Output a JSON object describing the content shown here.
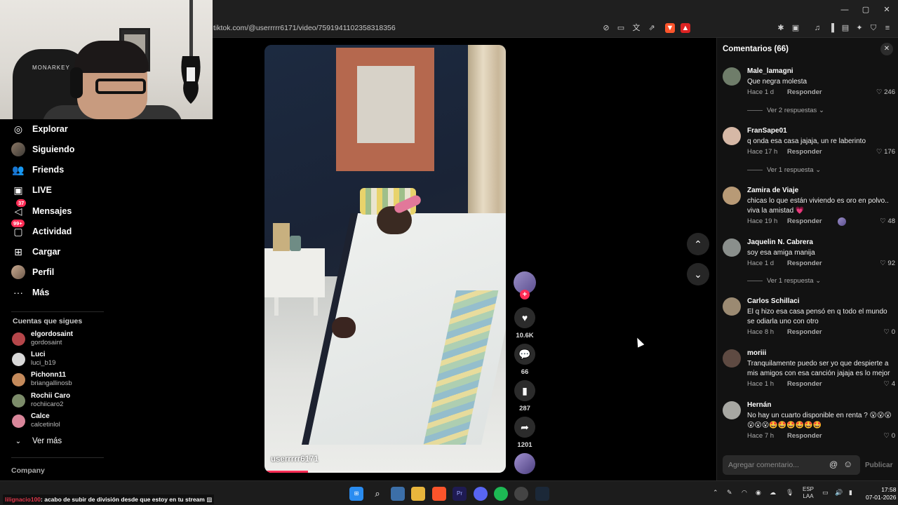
{
  "browser": {
    "url": "tiktok.com/@userrrrr6171/video/7591941102358318356",
    "window_controls": {
      "minimize": "—",
      "maximize": "▢",
      "close": "✕"
    }
  },
  "sidebar": {
    "nav": [
      {
        "label": "Explorar",
        "icon": "compass-icon"
      },
      {
        "label": "Siguiendo",
        "icon": "avatar-icon"
      },
      {
        "label": "Friends",
        "icon": "people-icon"
      },
      {
        "label": "LIVE",
        "icon": "live-icon"
      },
      {
        "label": "Mensajes",
        "icon": "message-icon",
        "badge": "37"
      },
      {
        "label": "Actividad",
        "icon": "activity-icon",
        "badge": "99+"
      },
      {
        "label": "Cargar",
        "icon": "upload-icon"
      },
      {
        "label": "Perfil",
        "icon": "profile-icon"
      },
      {
        "label": "Más",
        "icon": "more-icon"
      }
    ],
    "following_title": "Cuentas que sigues",
    "following": [
      {
        "name": "elgordosaint",
        "handle": "gordosaint",
        "color": "#b5464a"
      },
      {
        "name": "Luci",
        "handle": "luci_b19",
        "color": "#d8d8d8"
      },
      {
        "name": "Pichonn11",
        "handle": "briangallinosb",
        "color": "#c48a5b"
      },
      {
        "name": "Rochii Caro",
        "handle": "rochiicaro2",
        "color": "#7c8c6a"
      },
      {
        "name": "Calce",
        "handle": "calcetinlol",
        "color": "#d9869a"
      }
    ],
    "see_more": "Ver más",
    "company": "Company"
  },
  "video": {
    "username": "userrrrr6171",
    "progress_fraction": 0.18
  },
  "actions": {
    "likes": "10.6K",
    "comments": "66",
    "saves": "287",
    "shares": "1201"
  },
  "comments_panel": {
    "title": "Comentarios (66)",
    "reply_label": "Responder",
    "items": [
      {
        "name": "Male_lamagni",
        "text": "Que negra molesta",
        "time": "Hace 1 d",
        "likes": "246",
        "more": "Ver 2 respuestas",
        "avatar": "#6f7d6a"
      },
      {
        "name": "FranSape01",
        "text": "q onda esa casa jajaja, un re laberinto",
        "time": "Hace 17 h",
        "likes": "176",
        "more": "Ver 1 respuesta",
        "avatar": "#d6b8a6"
      },
      {
        "name": "Zamira de Viaje",
        "text": "chicas lo que están viviendo es oro en polvo.. viva la amistad 💗",
        "time": "Hace 19 h",
        "likes": "48",
        "more": "",
        "avatar": "#b89a76"
      },
      {
        "name": "Jaquelin N. Cabrera",
        "text": "soy esa amiga manija",
        "time": "Hace 1 d",
        "likes": "92",
        "more": "Ver 1 respuesta",
        "avatar": "#8a8f8c"
      },
      {
        "name": "Carlos Schillaci",
        "text": "El q hizo esa casa pensó en q todo el mundo se odiarla uno con otro",
        "time": "Hace 8 h",
        "likes": "0",
        "more": "",
        "avatar": "#9b8a72"
      },
      {
        "name": "moriii",
        "text": "Tranquilamente puedo ser yo que despierte a mis amigos con esa canción jajaja es lo mejor",
        "time": "Hace 1 h",
        "likes": "4",
        "more": "",
        "avatar": "#5e4a42"
      },
      {
        "name": "Hernán",
        "text": "No hay un cuarto disponible en renta ? 😮😮😮😮😮😮🤩🤩🤩🤩🤩🤩",
        "time": "Hace 7 h",
        "likes": "0",
        "more": "",
        "avatar": "#a7a7a2"
      }
    ],
    "input_placeholder": "Agregar comentario...",
    "publish": "Publicar"
  },
  "taskbar": {
    "chat_user": "lilignacio100",
    "chat_message": ": acabo de subir de división desde que estoy en tu stream",
    "lang": "ESP",
    "lang_sub": "LAA",
    "time": "17:58",
    "date": "07-01-2026"
  },
  "colors": {
    "accent": "#fe2c55",
    "panel": "#121212",
    "taskbar": "#1c1c1c"
  }
}
